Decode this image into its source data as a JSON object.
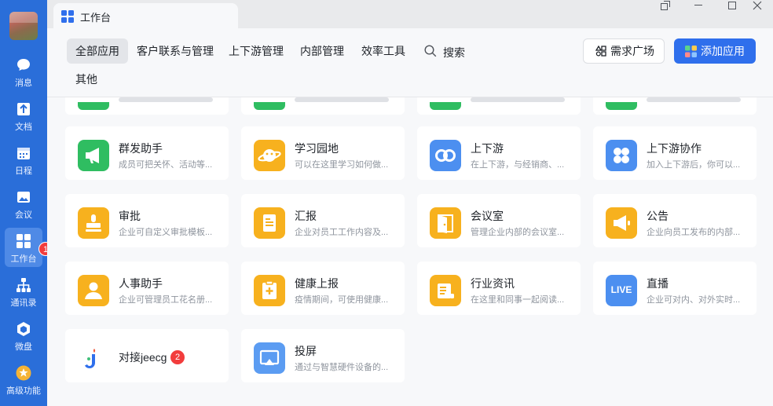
{
  "sidebar": {
    "items": [
      {
        "label": "消息",
        "icon": "chat-bubble-icon"
      },
      {
        "label": "文档",
        "icon": "document-icon"
      },
      {
        "label": "日程",
        "icon": "calendar-icon"
      },
      {
        "label": "会议",
        "icon": "meeting-icon"
      },
      {
        "label": "工作台",
        "icon": "workbench-grid-icon"
      },
      {
        "label": "通讯录",
        "icon": "contacts-tree-icon"
      },
      {
        "label": "微盘",
        "icon": "cloud-drive-icon"
      },
      {
        "label": "高级功能",
        "icon": "premium-star-icon"
      }
    ],
    "workbench_badge": "1"
  },
  "titlebar": {
    "tab_title": "工作台",
    "window_buttons": [
      "restore-popout",
      "minimize",
      "maximize",
      "close"
    ]
  },
  "toolbar": {
    "categories": [
      "全部应用",
      "客户联系与管理",
      "上下游管理",
      "内部管理",
      "效率工具"
    ],
    "categories_row2": [
      "其他"
    ],
    "search_label": "搜索",
    "demand_button": "需求广场",
    "add_button": "添加应用"
  },
  "apps": [
    {
      "name": "群发助手",
      "desc": "成员可把关怀、活动等...",
      "color": "#2fbd61",
      "icon": "megaphone-icon"
    },
    {
      "name": "学习园地",
      "desc": "可以在这里学习如何做...",
      "color": "#f7b11e",
      "icon": "planet-icon"
    },
    {
      "name": "上下游",
      "desc": "在上下游，与经销商、...",
      "color": "#4c8ff0",
      "icon": "link-icon"
    },
    {
      "name": "上下游协作",
      "desc": "加入上下游后，你可以...",
      "color": "#4c8ff0",
      "icon": "clover-icon"
    },
    {
      "name": "审批",
      "desc": "企业可自定义审批模板...",
      "color": "#f7b11e",
      "icon": "stamp-icon"
    },
    {
      "name": "汇报",
      "desc": "企业对员工工作内容及...",
      "color": "#f7b11e",
      "icon": "report-icon"
    },
    {
      "name": "会议室",
      "desc": "管理企业内部的会议室...",
      "color": "#f7b11e",
      "icon": "door-icon"
    },
    {
      "name": "公告",
      "desc": "企业向员工发布的内部...",
      "color": "#f7b11e",
      "icon": "announcement-icon"
    },
    {
      "name": "人事助手",
      "desc": "企业可管理员工花名册...",
      "color": "#f7b11e",
      "icon": "person-icon"
    },
    {
      "name": "健康上报",
      "desc": "疫情期间，可使用健康...",
      "color": "#f7b11e",
      "icon": "clipboard-plus-icon"
    },
    {
      "name": "行业资讯",
      "desc": "在这里和同事一起阅读...",
      "color": "#f7b11e",
      "icon": "news-icon"
    },
    {
      "name": "直播",
      "desc": "企业可对内、对外实时...",
      "color": "#4c8ff0",
      "icon": "live-icon",
      "icon_text": "LIVE"
    },
    {
      "name": "对接jeecg",
      "desc": "",
      "color": "#ffffff",
      "icon": "jeecg-logo-icon",
      "badge": "2"
    },
    {
      "name": "投屏",
      "desc": "通过与智慧硬件设备的...",
      "color": "#5b9cf2",
      "icon": "screen-cast-icon"
    }
  ]
}
